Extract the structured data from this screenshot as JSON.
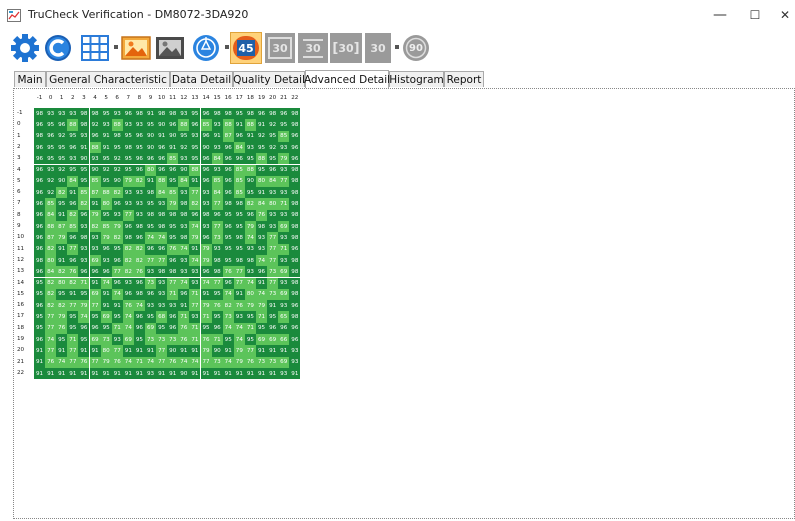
{
  "window": {
    "title": "TruCheck Verification - DM8072-3DA920",
    "minimize_symbol": "—",
    "maximize_symbol": "☐",
    "close_symbol": "✕"
  },
  "toolbar": {
    "icons": [
      "gear-icon",
      "refresh-icon",
      "grid-icon",
      "image-color-icon",
      "image-gray-icon",
      "aperture-icon",
      "angle-45-icon",
      "angle-30-box-icon",
      "angle-30-icon",
      "angle-30-bracket-icon",
      "angle-30-plain-icon",
      "angle-90-icon"
    ],
    "labels": {
      "a45": "45",
      "a30b": "30",
      "a30": "30",
      "a30c": "30",
      "a30p": "30",
      "a90": "90"
    },
    "grip": "="
  },
  "tabs": [
    "Main",
    "General Characteristic",
    "Data Detail",
    "Quality Detail",
    "Advanced Detail",
    "Histogram",
    "Report"
  ],
  "active_tab": "Advanced Detail",
  "colors": {
    "high": "#1a8a3c",
    "low": "#5cc45a",
    "text": "#ffffff"
  },
  "matrix": {
    "col_headers": [
      "-1",
      "0",
      "1",
      "2",
      "3",
      "4",
      "5",
      "6",
      "7",
      "8",
      "9",
      "10",
      "11",
      "12",
      "13",
      "14",
      "15",
      "16",
      "17",
      "18",
      "19",
      "20",
      "21",
      "22"
    ],
    "row_headers": [
      "-1",
      "0",
      "1",
      "2",
      "3",
      "4",
      "5",
      "6",
      "7",
      "8",
      "9",
      "10",
      "11",
      "12",
      "13",
      "14",
      "15",
      "16",
      "17",
      "18",
      "19",
      "20",
      "21",
      "22"
    ],
    "rows": [
      [
        "98",
        "93",
        "93",
        "93",
        "98",
        "98",
        "95",
        "93",
        "96",
        "98",
        "91",
        "98",
        "98",
        "93",
        "95",
        "96",
        "98",
        "98",
        "95",
        "98",
        "96",
        "98",
        "96",
        "98"
      ],
      [
        "96",
        "95",
        "96",
        "88",
        "98",
        "92",
        "93",
        "88",
        "93",
        "93",
        "95",
        "90",
        "96",
        "88",
        "96",
        "85",
        "93",
        "88",
        "91",
        "88",
        "91",
        "92",
        "95",
        "98"
      ],
      [
        "98",
        "96",
        "92",
        "95",
        "93",
        "96",
        "91",
        "98",
        "95",
        "96",
        "90",
        "91",
        "90",
        "95",
        "93",
        "96",
        "91",
        "87",
        "96",
        "91",
        "92",
        "95",
        "85",
        "96"
      ],
      [
        "96",
        "95",
        "95",
        "96",
        "91",
        "88",
        "91",
        "95",
        "98",
        "95",
        "90",
        "96",
        "91",
        "92",
        "95",
        "90",
        "93",
        "96",
        "84",
        "93",
        "95",
        "92",
        "93",
        "96"
      ],
      [
        "96",
        "95",
        "95",
        "93",
        "90",
        "93",
        "95",
        "92",
        "95",
        "96",
        "96",
        "96",
        "85",
        "93",
        "95",
        "96",
        "84",
        "96",
        "96",
        "95",
        "88",
        "95",
        "79",
        "96"
      ],
      [
        "96",
        "93",
        "92",
        "95",
        "95",
        "90",
        "92",
        "92",
        "95",
        "96",
        "80",
        "96",
        "96",
        "90",
        "88",
        "96",
        "93",
        "96",
        "85",
        "88",
        "95",
        "96",
        "93",
        "98"
      ],
      [
        "96",
        "92",
        "90",
        "84",
        "95",
        "85",
        "95",
        "90",
        "79",
        "82",
        "91",
        "88",
        "95",
        "84",
        "91",
        "96",
        "85",
        "96",
        "85",
        "90",
        "80",
        "84",
        "77",
        "98"
      ],
      [
        "96",
        "92",
        "82",
        "91",
        "85",
        "87",
        "88",
        "82",
        "93",
        "93",
        "98",
        "84",
        "85",
        "93",
        "77",
        "93",
        "84",
        "96",
        "85",
        "95",
        "91",
        "93",
        "93",
        "98"
      ],
      [
        "96",
        "85",
        "95",
        "96",
        "82",
        "91",
        "80",
        "96",
        "93",
        "93",
        "95",
        "93",
        "79",
        "98",
        "82",
        "93",
        "77",
        "98",
        "98",
        "82",
        "84",
        "80",
        "71",
        "98"
      ],
      [
        "96",
        "84",
        "91",
        "82",
        "96",
        "79",
        "95",
        "93",
        "77",
        "93",
        "98",
        "98",
        "98",
        "98",
        "96",
        "98",
        "96",
        "95",
        "95",
        "96",
        "76",
        "93",
        "93",
        "98"
      ],
      [
        "96",
        "88",
        "87",
        "85",
        "93",
        "82",
        "85",
        "79",
        "96",
        "98",
        "95",
        "98",
        "95",
        "93",
        "74",
        "93",
        "77",
        "96",
        "95",
        "79",
        "98",
        "93",
        "69",
        "98"
      ],
      [
        "96",
        "87",
        "79",
        "96",
        "98",
        "93",
        "79",
        "82",
        "98",
        "96",
        "74",
        "74",
        "95",
        "98",
        "79",
        "96",
        "73",
        "95",
        "98",
        "74",
        "93",
        "77",
        "93",
        "98"
      ],
      [
        "96",
        "82",
        "91",
        "77",
        "93",
        "93",
        "96",
        "95",
        "82",
        "82",
        "96",
        "96",
        "76",
        "74",
        "91",
        "79",
        "93",
        "95",
        "95",
        "93",
        "93",
        "77",
        "71",
        "96"
      ],
      [
        "98",
        "80",
        "91",
        "96",
        "93",
        "69",
        "93",
        "96",
        "82",
        "82",
        "77",
        "77",
        "96",
        "93",
        "74",
        "79",
        "98",
        "95",
        "98",
        "98",
        "74",
        "77",
        "93",
        "98"
      ],
      [
        "96",
        "84",
        "82",
        "76",
        "96",
        "96",
        "96",
        "77",
        "82",
        "76",
        "93",
        "98",
        "98",
        "93",
        "93",
        "96",
        "98",
        "76",
        "77",
        "93",
        "96",
        "73",
        "69",
        "98"
      ],
      [
        "95",
        "82",
        "80",
        "82",
        "71",
        "91",
        "74",
        "96",
        "93",
        "96",
        "73",
        "93",
        "77",
        "74",
        "93",
        "74",
        "77",
        "96",
        "77",
        "74",
        "91",
        "77",
        "93",
        "98"
      ],
      [
        "95",
        "82",
        "95",
        "91",
        "95",
        "69",
        "91",
        "74",
        "96",
        "98",
        "96",
        "93",
        "71",
        "96",
        "71",
        "91",
        "95",
        "74",
        "91",
        "80",
        "74",
        "73",
        "69",
        "98"
      ],
      [
        "96",
        "82",
        "82",
        "77",
        "79",
        "77",
        "91",
        "91",
        "76",
        "74",
        "93",
        "93",
        "93",
        "91",
        "77",
        "79",
        "76",
        "82",
        "76",
        "79",
        "79",
        "91",
        "93",
        "96"
      ],
      [
        "95",
        "77",
        "79",
        "95",
        "74",
        "95",
        "69",
        "95",
        "74",
        "96",
        "95",
        "68",
        "96",
        "71",
        "93",
        "71",
        "95",
        "73",
        "93",
        "95",
        "71",
        "95",
        "65",
        "98"
      ],
      [
        "95",
        "77",
        "76",
        "95",
        "96",
        "96",
        "95",
        "71",
        "74",
        "96",
        "69",
        "95",
        "96",
        "76",
        "71",
        "95",
        "96",
        "74",
        "74",
        "71",
        "95",
        "96",
        "96",
        "96"
      ],
      [
        "96",
        "74",
        "95",
        "71",
        "95",
        "69",
        "73",
        "93",
        "69",
        "95",
        "73",
        "73",
        "73",
        "76",
        "71",
        "76",
        "71",
        "95",
        "74",
        "95",
        "69",
        "69",
        "66",
        "96"
      ],
      [
        "91",
        "77",
        "91",
        "77",
        "91",
        "91",
        "80",
        "77",
        "91",
        "91",
        "91",
        "77",
        "90",
        "91",
        "91",
        "79",
        "90",
        "91",
        "79",
        "77",
        "91",
        "91",
        "91",
        "93"
      ],
      [
        "91",
        "76",
        "74",
        "77",
        "76",
        "77",
        "79",
        "76",
        "74",
        "71",
        "74",
        "77",
        "76",
        "74",
        "74",
        "77",
        "73",
        "74",
        "79",
        "76",
        "73",
        "73",
        "69",
        "93"
      ],
      [
        "91",
        "91",
        "91",
        "91",
        "91",
        "91",
        "91",
        "91",
        "91",
        "91",
        "93",
        "91",
        "91",
        "90",
        "91",
        "91",
        "91",
        "91",
        "91",
        "91",
        "91",
        "91",
        "93",
        "91"
      ]
    ]
  }
}
